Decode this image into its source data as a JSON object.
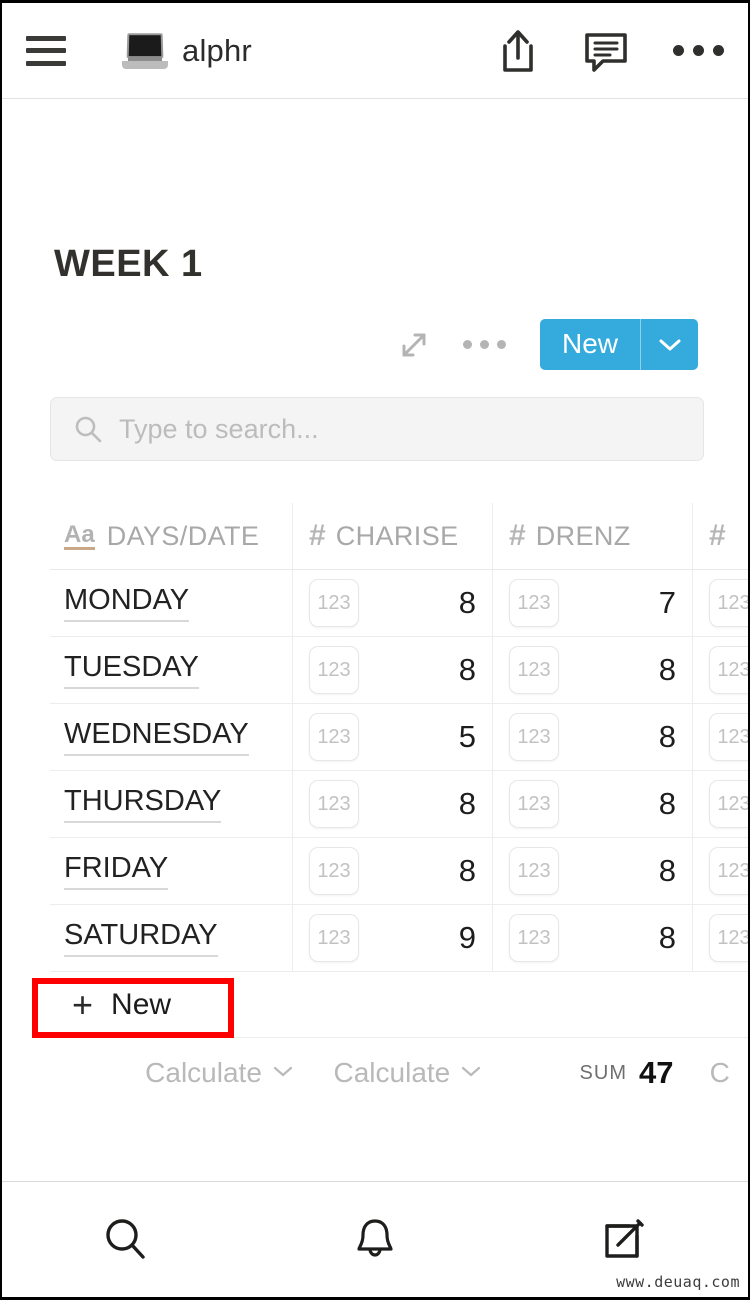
{
  "appbar": {
    "menu_icon": "hamburger-icon",
    "brand_icon": "laptop-icon",
    "brand_name": "alphr",
    "share_icon": "share-icon",
    "comment_icon": "comment-icon",
    "overflow_icon": "more-horizontal-icon"
  },
  "page": {
    "title": "WEEK 1"
  },
  "toolbar": {
    "expand_icon": "expand-diagonal-icon",
    "more_icon": "more-horizontal-icon",
    "new_label": "New",
    "new_caret_icon": "chevron-down-icon",
    "accent_color": "#35aadc"
  },
  "search": {
    "icon": "search-icon",
    "placeholder": "Type to search...",
    "value": ""
  },
  "table": {
    "columns": [
      {
        "label": "DAYS/DATE",
        "type_icon": "text-type-icon",
        "type_glyph": "Aa"
      },
      {
        "label": "CHARISE",
        "type_icon": "number-type-icon",
        "type_glyph": "#"
      },
      {
        "label": "DRENZ",
        "type_icon": "number-type-icon",
        "type_glyph": "#"
      },
      {
        "label": "",
        "type_icon": "number-type-icon",
        "type_glyph": "#"
      }
    ],
    "badge_label": "123",
    "rows": [
      {
        "day": "MONDAY",
        "charise": "8",
        "drenz": "7"
      },
      {
        "day": "TUESDAY",
        "charise": "8",
        "drenz": "8"
      },
      {
        "day": "WEDNESDAY",
        "charise": "5",
        "drenz": "8"
      },
      {
        "day": "THURSDAY",
        "charise": "8",
        "drenz": "8"
      },
      {
        "day": "FRIDAY",
        "charise": "8",
        "drenz": "8"
      },
      {
        "day": "SATURDAY",
        "charise": "9",
        "drenz": "8"
      }
    ],
    "add_row": {
      "plus": "+",
      "label": "New",
      "highlight_color": "#ff0000"
    },
    "summary": {
      "calc_label_1": "Calculate",
      "calc_label_2": "Calculate",
      "sum_label": "SUM",
      "sum_value": "47",
      "calc_label_3": "C"
    }
  },
  "bottomnav": {
    "items": [
      {
        "icon": "search-icon"
      },
      {
        "icon": "bell-icon"
      },
      {
        "icon": "compose-icon"
      }
    ]
  },
  "watermark": "www.deuaq.com"
}
